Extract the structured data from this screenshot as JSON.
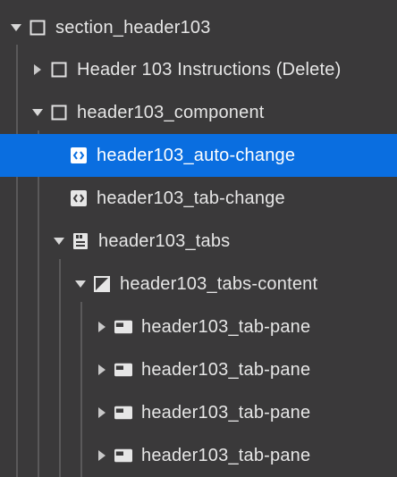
{
  "navigator": {
    "rows": [
      {
        "label": "section_header103",
        "icon": "box-icon",
        "toggle": "expanded"
      },
      {
        "label": "Header 103 Instructions (Delete)",
        "icon": "box-icon",
        "toggle": "collapsed"
      },
      {
        "label": "header103_component",
        "icon": "box-icon",
        "toggle": "expanded"
      },
      {
        "label": "header103_auto-change",
        "icon": "embed-icon",
        "toggle": "none",
        "selected": true
      },
      {
        "label": "header103_tab-change",
        "icon": "embed-icon",
        "toggle": "none"
      },
      {
        "label": "header103_tabs",
        "icon": "tabs-icon",
        "toggle": "expanded"
      },
      {
        "label": "header103_tabs-content",
        "icon": "tabs-content-icon",
        "toggle": "expanded"
      },
      {
        "label": "header103_tab-pane",
        "icon": "tab-pane-icon",
        "toggle": "collapsed"
      },
      {
        "label": "header103_tab-pane",
        "icon": "tab-pane-icon",
        "toggle": "collapsed"
      },
      {
        "label": "header103_tab-pane",
        "icon": "tab-pane-icon",
        "toggle": "collapsed"
      },
      {
        "label": "header103_tab-pane",
        "icon": "tab-pane-icon",
        "toggle": "collapsed"
      }
    ],
    "colors": {
      "background": "#3a393a",
      "selected": "#0a6ee0",
      "text": "#e6e6e6",
      "guide": "#5a595a"
    }
  }
}
